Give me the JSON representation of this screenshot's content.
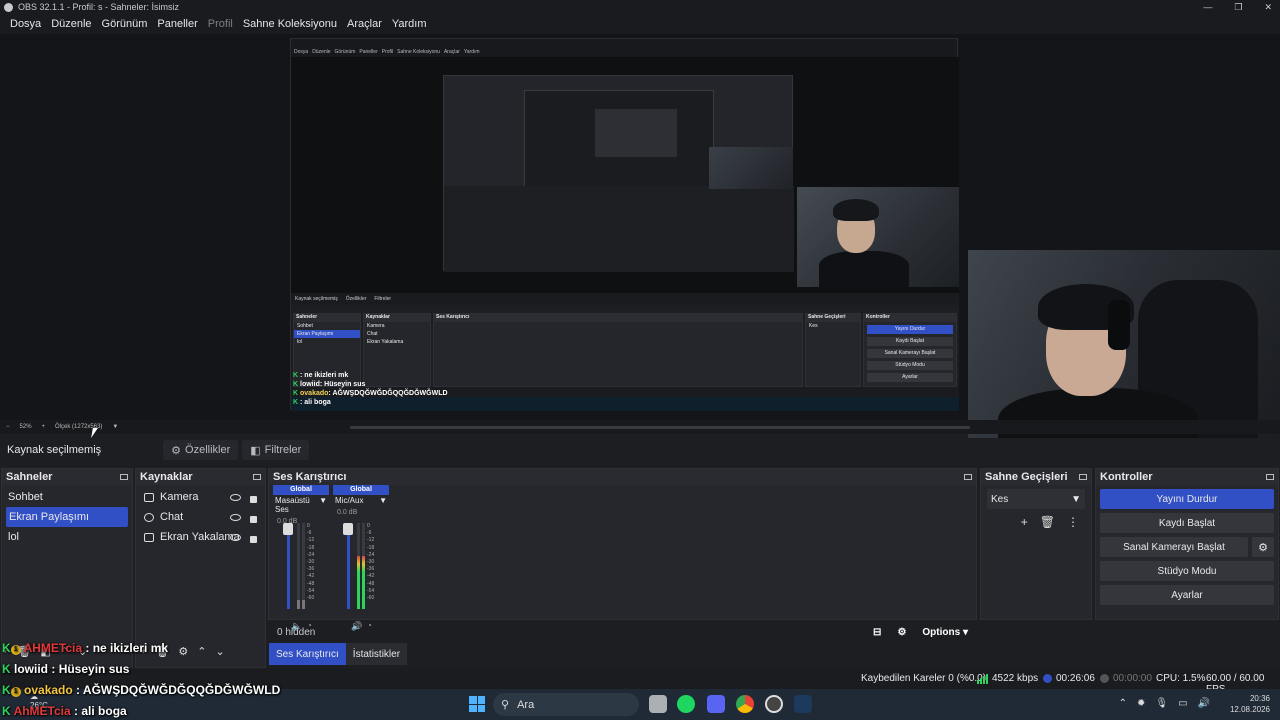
{
  "window": {
    "title": "OBS 32.1.1 - Profil: s - Sahneler: İsimsiz"
  },
  "menu": [
    {
      "label": "Dosya",
      "enabled": true
    },
    {
      "label": "Düzenle",
      "enabled": true
    },
    {
      "label": "Görünüm",
      "enabled": true
    },
    {
      "label": "Paneller",
      "enabled": true
    },
    {
      "label": "Profil",
      "enabled": false
    },
    {
      "label": "Sahne Koleksiyonu",
      "enabled": true
    },
    {
      "label": "Araçlar",
      "enabled": true
    },
    {
      "label": "Yardım",
      "enabled": true
    }
  ],
  "zoom": {
    "percent": "52%",
    "scale": "Ölçek (1272x563)"
  },
  "source_toolbar": {
    "label": "Kaynak seçilmemiş",
    "properties": "Özellikler",
    "filters": "Filtreler"
  },
  "scenes": {
    "title": "Sahneler",
    "items": [
      {
        "label": "Sohbet",
        "selected": false
      },
      {
        "label": "Ekran Paylaşımı",
        "selected": true
      },
      {
        "label": "lol",
        "selected": false
      }
    ]
  },
  "sources": {
    "title": "Kaynaklar",
    "items": [
      {
        "label": "Kamera",
        "icon": "camera-icon"
      },
      {
        "label": "Chat",
        "icon": "globe-icon"
      },
      {
        "label": "Ekran Yakalama",
        "icon": "monitor-icon"
      }
    ]
  },
  "mixer": {
    "title": "Ses Karıştırıcı",
    "channels": [
      {
        "global": "Global",
        "name": "Masaüstü Ses",
        "db": "0.0 dB",
        "level": 0.1,
        "muted": true
      },
      {
        "global": "Global",
        "name": "Mic/Aux",
        "db": "0.0 dB",
        "level": 0.62,
        "muted": false
      }
    ],
    "ticks": [
      "0",
      "-6",
      "-12",
      "-18",
      "-24",
      "-30",
      "-36",
      "-42",
      "-48",
      "-54",
      "-60"
    ],
    "hidden": "0 hidden",
    "options": "Options",
    "tabs": [
      "Ses Karıştırıcı",
      "İstatistikler"
    ]
  },
  "transitions": {
    "title": "Sahne Geçişleri",
    "selected": "Kes"
  },
  "controls": {
    "title": "Kontroller",
    "stop_stream": "Yayını Durdur",
    "start_record": "Kaydı Başlat",
    "virtual_cam": "Sanal Kamerayı Başlat",
    "studio_mode": "Stüdyo Modu",
    "settings": "Ayarlar"
  },
  "chat": [
    {
      "user": "AHMETcia",
      "msg": ": ne ikizleri mk",
      "user_color": "#e23a3a",
      "badge": "1"
    },
    {
      "user": "lowiid",
      "msg": ": Hüseyin sus",
      "user_color": "#ffffff",
      "badge": ""
    },
    {
      "user": "ovakado",
      "msg": ": AĞWŞDQĞWĞDĞQQĞDĞWĞWLD",
      "user_color": "#f5c542",
      "badge": "1"
    },
    {
      "user": "AhMETcia",
      "msg": ": ali boga",
      "user_color": "#e23a3a",
      "badge": ""
    }
  ],
  "status": {
    "dropped": "Kaybedilen Kareler 0 (%0.0)",
    "kbps": "4522 kbps",
    "stream_time": "00:26:06",
    "record_time": "00:00:00",
    "cpu": "CPU: 1.5%",
    "fps": "60.00 / 60.00 FPS"
  },
  "taskbar": {
    "search": "Ara",
    "weather": "26°C",
    "time": "20:36",
    "date": "12.08.2026"
  },
  "nested": {
    "chat": [
      {
        "user": "",
        "msg": ": ne ikizleri mk"
      },
      {
        "user": "lowiid",
        "msg": ": Hüseyin sus"
      },
      {
        "user": "ovakado",
        "msg": ": AĞWŞDQĞWĞDĞQQĞDĞWĞWLD"
      },
      {
        "user": "",
        "msg": ": ali boga"
      }
    ]
  },
  "colors": {
    "accent": "#3250c6",
    "bg": "#1d1e22",
    "green": "#2fd25a"
  }
}
